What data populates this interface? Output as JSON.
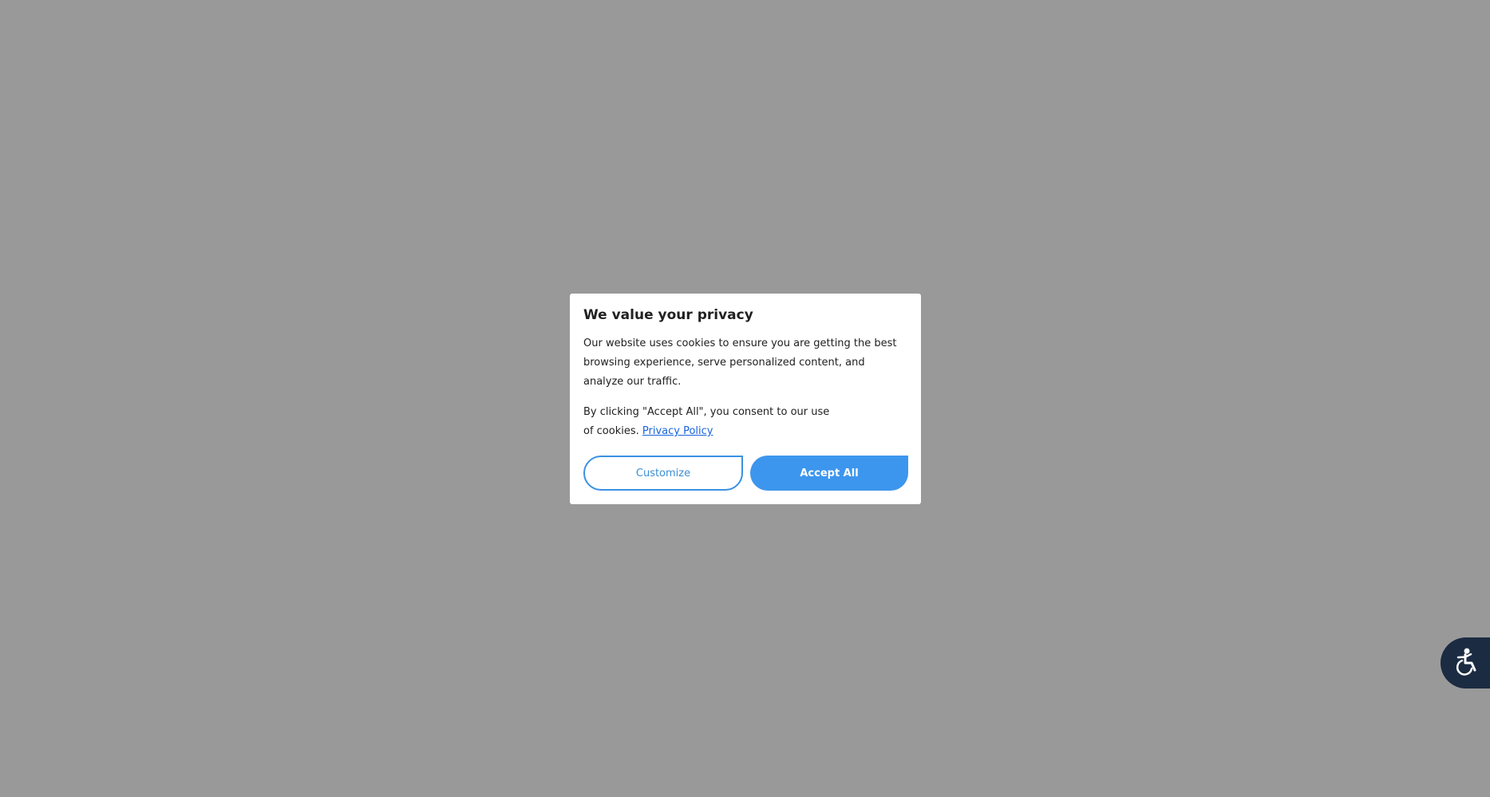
{
  "dialog": {
    "title": "We value your privacy",
    "description": "Our website uses cookies to ensure you are getting the best browsing experience, serve personalized content, and analyze our traffic.",
    "consent_text": "By clicking \"Accept All\", you consent to our use of cookies.",
    "privacy_link_label": "Privacy Policy",
    "customize_label": "Customize",
    "accept_label": "Accept All"
  },
  "accessibility_widget": {
    "icon": "accessibility-icon"
  },
  "colors": {
    "overlay": "#999999",
    "accent": "#3d96ed",
    "link": "#1863dc",
    "widget_bg": "#1b2b42"
  }
}
